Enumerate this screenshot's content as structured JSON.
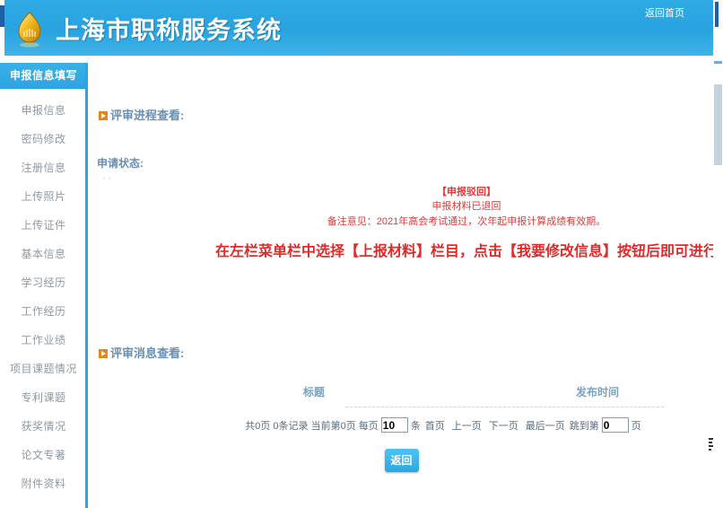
{
  "header": {
    "title": "上海市职称服务系统",
    "home_link": "返回首页",
    "logo_icon": "shield-logo-icon"
  },
  "sidebar": {
    "heading": "申报信息填写",
    "items": [
      {
        "label": "申报信息"
      },
      {
        "label": "密码修改"
      },
      {
        "label": "注册信息"
      },
      {
        "label": "上传照片"
      },
      {
        "label": "上传证件"
      },
      {
        "label": "基本信息"
      },
      {
        "label": "学习经历"
      },
      {
        "label": "工作经历"
      },
      {
        "label": "工作业绩"
      },
      {
        "label": "项目课题情况"
      },
      {
        "label": "专利课题"
      },
      {
        "label": "获奖情况"
      },
      {
        "label": "论文专著"
      },
      {
        "label": "附件资料"
      }
    ]
  },
  "main": {
    "section_progress_title": "评审进程查看:",
    "section_message_title": "评审消息查看:",
    "status_label": "申请状态:",
    "status_dots": "· ·",
    "status_stage": "【申报驳回】",
    "status_detail": "申报材料已退回",
    "status_remark": "备注意见：2021年高会考试通过，次年起申报计算成绩有效期。",
    "notice": "在左栏菜单栏中选择【上报材料】栏目，点击【我要修改信息】按钮后即可进行信息的修改。",
    "table": {
      "columns": [
        "标题",
        "发布时间"
      ],
      "rows": []
    },
    "pager": {
      "total_text": "共0页 0条记录 当前第0页 每页",
      "page_size": "10",
      "unit_text": "条",
      "first": "首页",
      "prev": "上一页",
      "next": "下一页",
      "last": "最后一页",
      "jump_label": "跳到第",
      "jump_value": "0",
      "jump_unit": "页"
    },
    "back_button": "返回"
  },
  "colors": {
    "brand_blue": "#2ba5e2",
    "accent_orange": "#e8821e",
    "alert_red": "#e02a2a",
    "heading_blue": "#6b8fb0"
  }
}
